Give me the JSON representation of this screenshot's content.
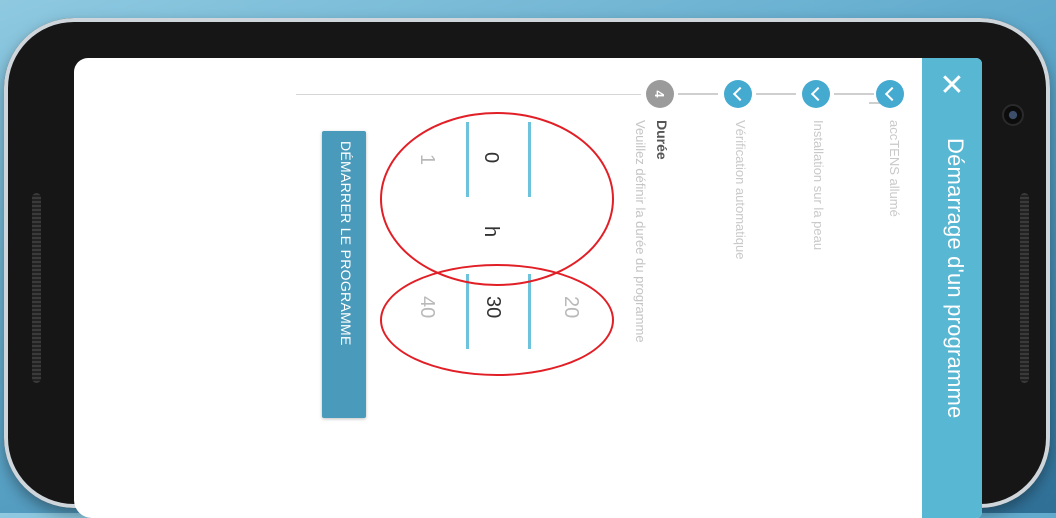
{
  "app": {
    "title": "Démarrage d'un programme",
    "close_icon": "close-icon"
  },
  "stepper": {
    "steps": [
      {
        "label": "accTENS allumé",
        "state": "done"
      },
      {
        "label": "Installation sur la peau",
        "state": "done"
      },
      {
        "label": "Vérification automatique",
        "state": "done"
      },
      {
        "label": "Durée",
        "state": "active",
        "number": "4",
        "description": "Veuillez définir la durée du programme"
      }
    ]
  },
  "duration": {
    "hours": {
      "above": "",
      "selected": "0",
      "below": "1"
    },
    "unit": "h",
    "minutes": {
      "above": "20",
      "selected": "30",
      "below": "40"
    }
  },
  "actions": {
    "start_label": "DÉMARRER LE PROGRAMME"
  },
  "colors": {
    "appbar": "#58b7d3",
    "step_done": "#45aad0",
    "step_active": "#9b9b9b",
    "button": "#4a9bbb",
    "annotation": "#e11f26"
  }
}
